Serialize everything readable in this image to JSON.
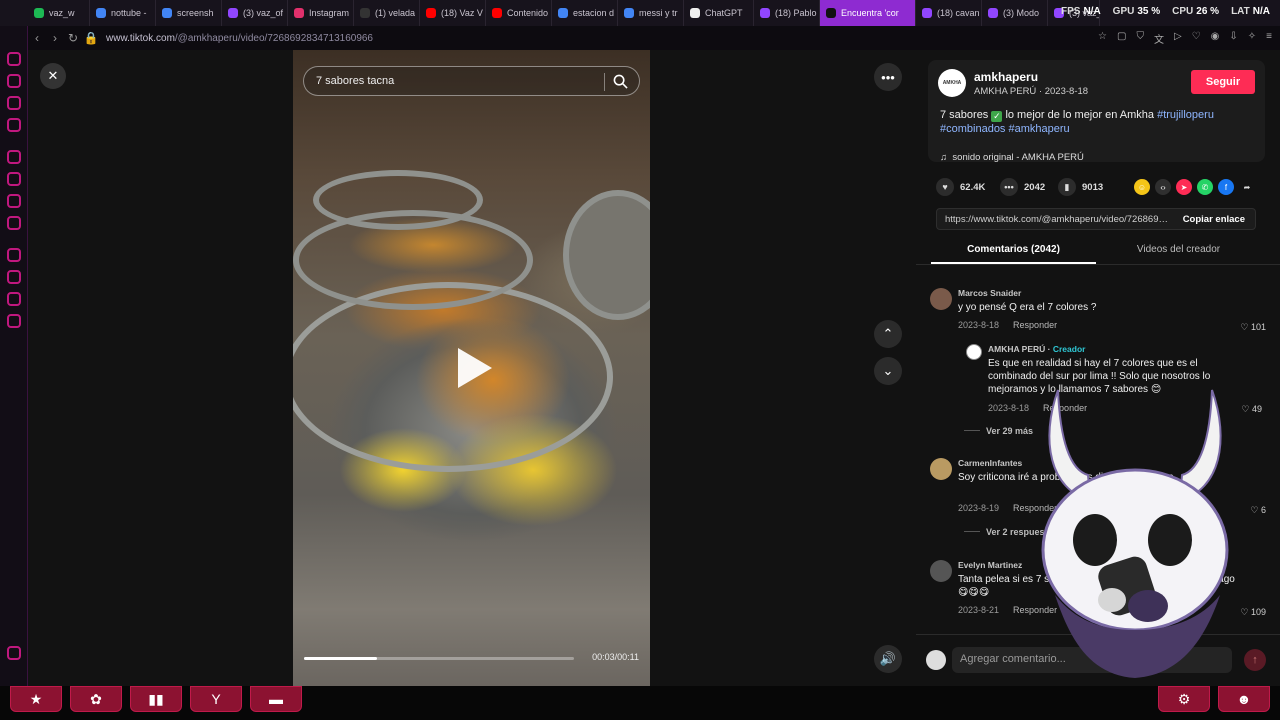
{
  "browser": {
    "tabs": [
      {
        "title": "",
        "fav": "#2a2a2a"
      },
      {
        "title": "vaz_w",
        "fav": "#1db954"
      },
      {
        "title": "nottube -",
        "fav": "#4285f4"
      },
      {
        "title": "screensh",
        "fav": "#4285f4"
      },
      {
        "title": "(3) vaz_of",
        "fav": "#9146ff"
      },
      {
        "title": "Instagram",
        "fav": "#e1306c"
      },
      {
        "title": "(1) velada",
        "fav": "#333333"
      },
      {
        "title": "(18) Vaz V",
        "fav": "#ff0000"
      },
      {
        "title": "Contenido",
        "fav": "#ff0000"
      },
      {
        "title": "estacion d",
        "fav": "#4285f4"
      },
      {
        "title": "messi y tr",
        "fav": "#4285f4"
      },
      {
        "title": "ChatGPT",
        "fav": "#eeeeee"
      },
      {
        "title": "(18) Pablo",
        "fav": "#9146ff"
      },
      {
        "title": "Encuentra 'cor",
        "fav": "#111111",
        "active": true
      },
      {
        "title": "(18) cavan",
        "fav": "#9146ff"
      },
      {
        "title": "(3) Modo",
        "fav": "#9146ff"
      },
      {
        "title": "(3) vaz_o",
        "fav": "#9146ff"
      }
    ],
    "url_host": "www.tiktok.com",
    "url_path": "/@amkhaperu/video/7268692834713160966",
    "stats": {
      "fps_label": "FPS",
      "fps": "N/A",
      "gpu_label": "GPU",
      "gpu": "35 %",
      "cpu_label": "CPU",
      "cpu": "26 %",
      "lat_label": "LAT",
      "lat": "N/A"
    }
  },
  "video": {
    "search_placeholder": "7 sabores tacna",
    "time": "00:03/00:11",
    "progress": 0.27
  },
  "creator": {
    "avatar_text": "AMKHA",
    "username": "amkhaperu",
    "subline": "AMKHA PERÚ · 2023-8-18",
    "follow": "Seguir",
    "caption_prefix": "7 sabores",
    "caption_text": "lo mejor de lo mejor en Amkha",
    "hashtag1": "#trujilloperu",
    "hashtag2": "#combinados",
    "hashtag3": "#amkhaperu",
    "sound": "sonido original - AMKHA PERÚ"
  },
  "stats": {
    "likes": "62.4K",
    "comments": "2042",
    "saves": "9013"
  },
  "share_colors": [
    "#f5c518",
    "#2f2f2f",
    "#fe2c55",
    "#25d366",
    "#1877f2"
  ],
  "link": {
    "url": "https://www.tiktok.com/@amkhaperu/video/7268692834713160966",
    "copy": "Copiar enlace"
  },
  "panel_tabs": {
    "comments": "Comentarios (2042)",
    "videos": "Videos del creador"
  },
  "comments": [
    {
      "name": "Marcos Snaider",
      "text": "y yo pensé Q era el 7 colores ?",
      "date": "2023-8-18",
      "reply": "Responder",
      "likes": "101",
      "avatar": "#7a5a4a"
    },
    {
      "name": "AMKHA PERÚ",
      "badge": "Creador",
      "text": "Es que en realidad si hay el 7 colores que es el combinado del sur por lima !! Solo que nosotros lo mejoramos y lo llamamos 7 sabores 😊",
      "date": "2023-8-18",
      "reply": "Responder",
      "likes": "49",
      "avatar": "#ffffff"
    },
    {
      "more": "Ver 29 más"
    },
    {
      "name": "CarmenInfantes",
      "text": "Soy criticona iré a probar y les diré que tal les ve.",
      "date": "2023-8-19",
      "reply": "Responder",
      "likes": "6",
      "avatar": "#b99a62"
    },
    {
      "more": "Ver 2 respuestas"
    },
    {
      "name": "Evelyn Martinez",
      "text": "Tanta pelea si es 7 sabores o 7 colores todo llega al estómago 😋😋😋",
      "date": "2023-8-21",
      "reply": "Responder",
      "likes": "109",
      "avatar": "#555555"
    }
  ],
  "comment_placeholder": "Agregar comentario...",
  "taskbar": [
    "★",
    "✿",
    "▮▮",
    "Y",
    "▬"
  ]
}
